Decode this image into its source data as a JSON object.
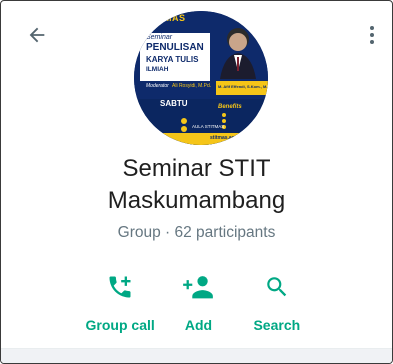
{
  "header": {
    "back_icon": "arrow-left-icon",
    "more_icon": "more-vertical-icon"
  },
  "avatar": {
    "brand": "MAS",
    "line1": "Seminar",
    "line2": "PENULISAN",
    "line3": "KARYA TULIS",
    "line4": "ILMIAH",
    "moderator_label": "Moderator",
    "moderator_name": "Ali Rosyidi, M.Pd.",
    "day": "SABTU",
    "venue": "AULA STITMAS",
    "speaker": "M. Afif Effendi, S.Kom., M.T.",
    "benefits_label": "Benefits",
    "footer_text": "stitmas.ac.id"
  },
  "group": {
    "name": "Seminar STIT Maskumambang",
    "meta": "Group · 62 participants"
  },
  "actions": [
    {
      "label": "Group call",
      "icon": "add-call-icon"
    },
    {
      "label": "Add",
      "icon": "add-person-icon"
    },
    {
      "label": "Search",
      "icon": "search-icon"
    }
  ],
  "colors": {
    "accent": "#00a884",
    "text_primary": "#1f1f1f",
    "text_secondary": "#667781",
    "avatar_bg": "#0e2a6b",
    "avatar_yellow": "#f5c518"
  }
}
